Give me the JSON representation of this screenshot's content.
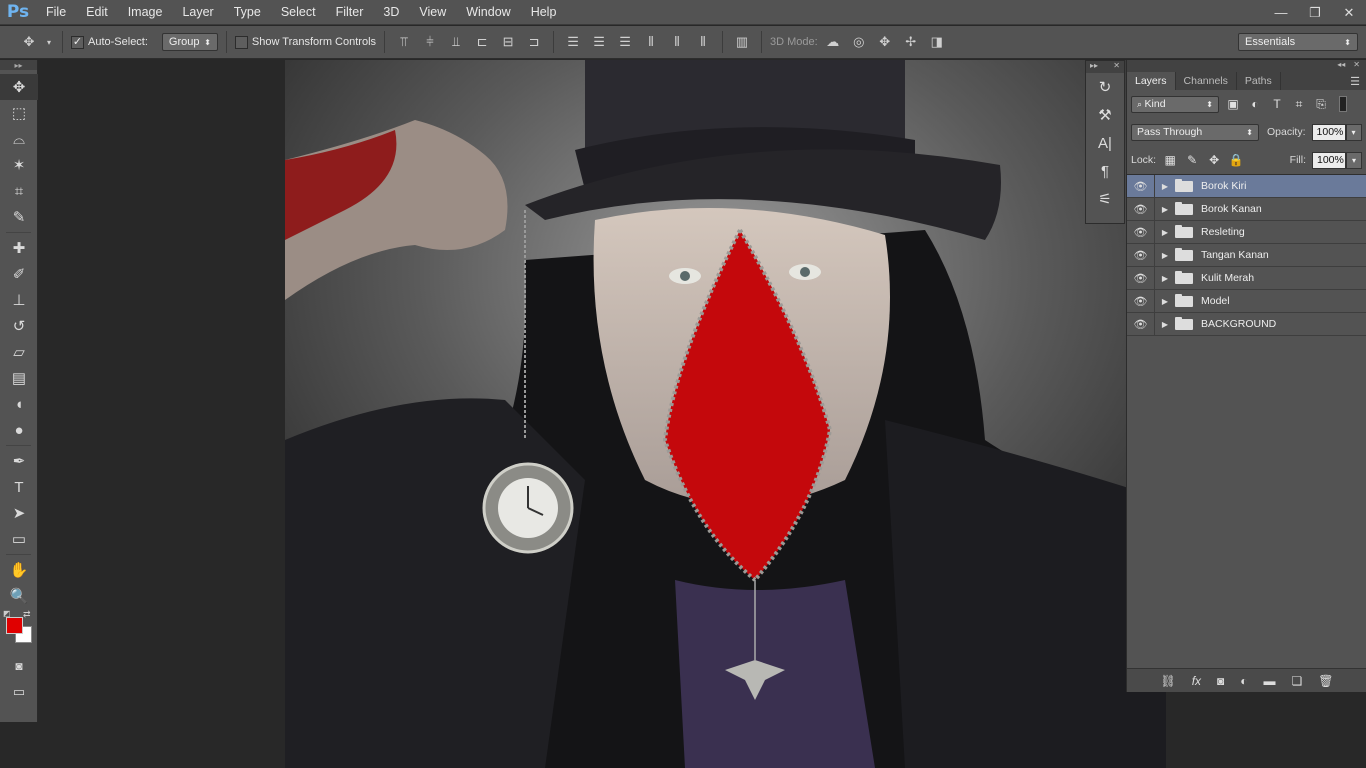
{
  "app": {
    "logo": "Ps"
  },
  "menu": [
    "File",
    "Edit",
    "Image",
    "Layer",
    "Type",
    "Select",
    "Filter",
    "3D",
    "View",
    "Window",
    "Help"
  ],
  "window_controls": {
    "minimize": "—",
    "restore": "❐",
    "close": "✕"
  },
  "options": {
    "auto_select_label": "Auto-Select:",
    "auto_select_checked": true,
    "auto_select_value": "Group",
    "show_transform_label": "Show Transform Controls",
    "show_transform_checked": false,
    "mode_3d_label": "3D Mode:",
    "workspace": "Essentials"
  },
  "tools": [
    {
      "name": "move-tool",
      "glyph": "✥",
      "active": true
    },
    {
      "name": "marquee-tool",
      "glyph": "⬚"
    },
    {
      "name": "lasso-tool",
      "glyph": "⌓"
    },
    {
      "name": "magic-wand-tool",
      "glyph": "✶"
    },
    {
      "name": "crop-tool",
      "glyph": "⌗"
    },
    {
      "name": "eyedropper-tool",
      "glyph": "✎"
    },
    {
      "name": "healing-brush-tool",
      "glyph": "✚"
    },
    {
      "name": "brush-tool",
      "glyph": "✐"
    },
    {
      "name": "clone-stamp-tool",
      "glyph": "⊥"
    },
    {
      "name": "history-brush-tool",
      "glyph": "↺"
    },
    {
      "name": "eraser-tool",
      "glyph": "▱"
    },
    {
      "name": "gradient-tool",
      "glyph": "▤"
    },
    {
      "name": "blur-tool",
      "glyph": "◖"
    },
    {
      "name": "dodge-tool",
      "glyph": "●"
    },
    {
      "name": "pen-tool",
      "glyph": "✒"
    },
    {
      "name": "type-tool",
      "glyph": "T"
    },
    {
      "name": "path-selection-tool",
      "glyph": "➤"
    },
    {
      "name": "rectangle-tool",
      "glyph": "▭"
    },
    {
      "name": "hand-tool",
      "glyph": "✋"
    },
    {
      "name": "zoom-tool",
      "glyph": "🔍"
    }
  ],
  "colors": {
    "foreground": "#e00000",
    "background": "#ffffff"
  },
  "layers_panel": {
    "tabs": [
      "Layers",
      "Channels",
      "Paths"
    ],
    "active_tab": "Layers",
    "filter_kind": "Kind",
    "blend_mode": "Pass Through",
    "opacity_label": "Opacity:",
    "opacity_value": "100%",
    "lock_label": "Lock:",
    "fill_label": "Fill:",
    "fill_value": "100%",
    "layers": [
      {
        "name": "Borok Kiri",
        "selected": true
      },
      {
        "name": "Borok Kanan"
      },
      {
        "name": "Resleting"
      },
      {
        "name": "Tangan Kanan"
      },
      {
        "name": "Kulit Merah"
      },
      {
        "name": "Model"
      },
      {
        "name": "BACKGROUND"
      }
    ],
    "footer_icons": [
      "link-icon",
      "fx-icon",
      "mask-icon",
      "adjustment-icon",
      "group-icon",
      "new-layer-icon",
      "trash-icon"
    ]
  },
  "mini_panel_tools": [
    "history-icon",
    "actions-icon",
    "character-icon",
    "paragraph-icon",
    "properties-icon"
  ]
}
